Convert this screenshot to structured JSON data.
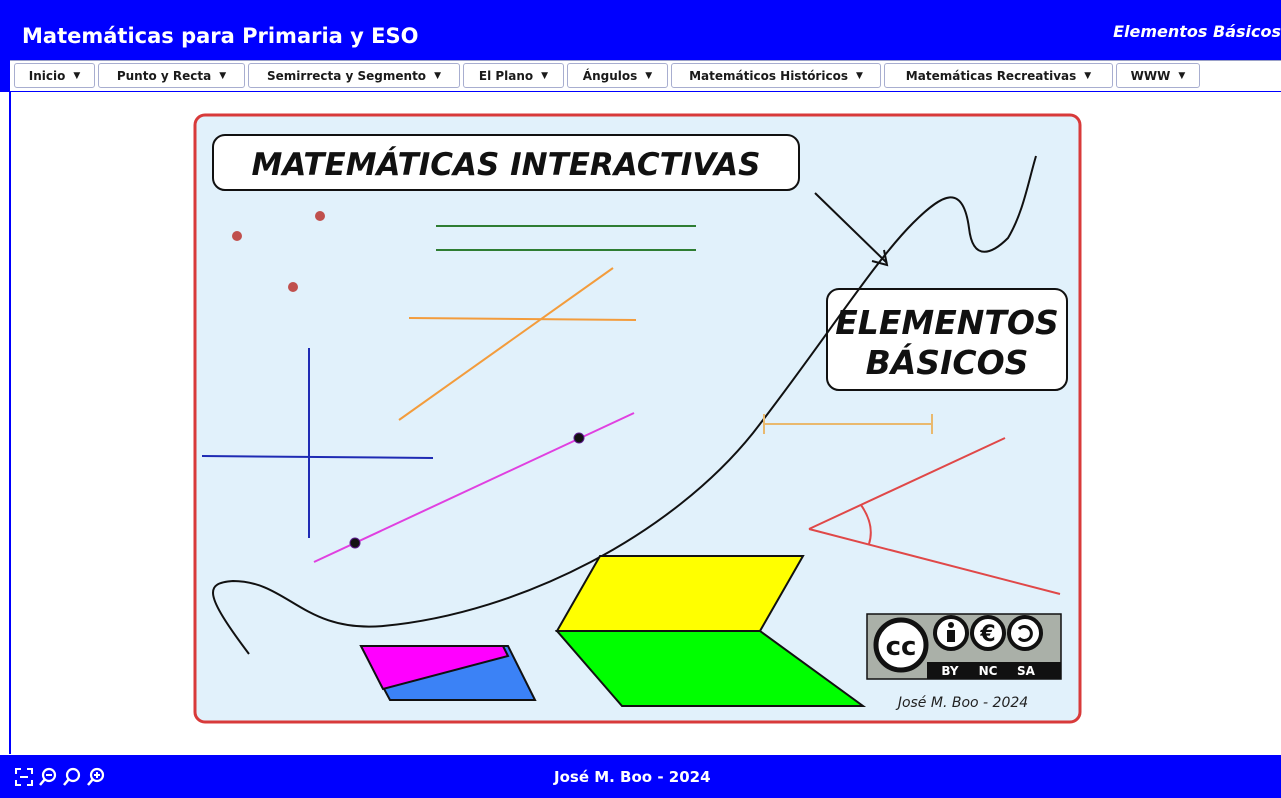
{
  "header": {
    "app_title": "Matemáticas para Primaria y ESO",
    "section_title": "Elementos Básicos"
  },
  "menu": [
    {
      "label": "Inicio"
    },
    {
      "label": "Punto y Recta"
    },
    {
      "label": "Semirrecta y Segmento"
    },
    {
      "label": "El Plano"
    },
    {
      "label": "Ángulos"
    },
    {
      "label": "Matemáticos Históricos"
    },
    {
      "label": "Matemáticas Recreativas"
    },
    {
      "label": "WWW"
    }
  ],
  "canvas": {
    "banner_title": "MATEMÁTICAS INTERACTIVAS",
    "subtitle_line1": "ELEMENTOS",
    "subtitle_line2": "BÁSICOS",
    "license_labels": [
      "BY",
      "NC",
      "SA"
    ],
    "license_cc": "cc",
    "credit": "José M. Boo - 2024"
  },
  "footer": {
    "author": "José M. Boo - 2024",
    "tools": [
      "fullscreen-icon",
      "zoom-out-icon",
      "zoom-reset-icon",
      "zoom-in-icon"
    ]
  },
  "colors": {
    "brand_blue": "#0000ff",
    "canvas_bg": "#e1f1fb",
    "canvas_border": "#d83a3a",
    "yellow": "#ffff00",
    "green": "#00ff00",
    "magenta": "#ff00ff",
    "blue": "#3b82f6"
  }
}
